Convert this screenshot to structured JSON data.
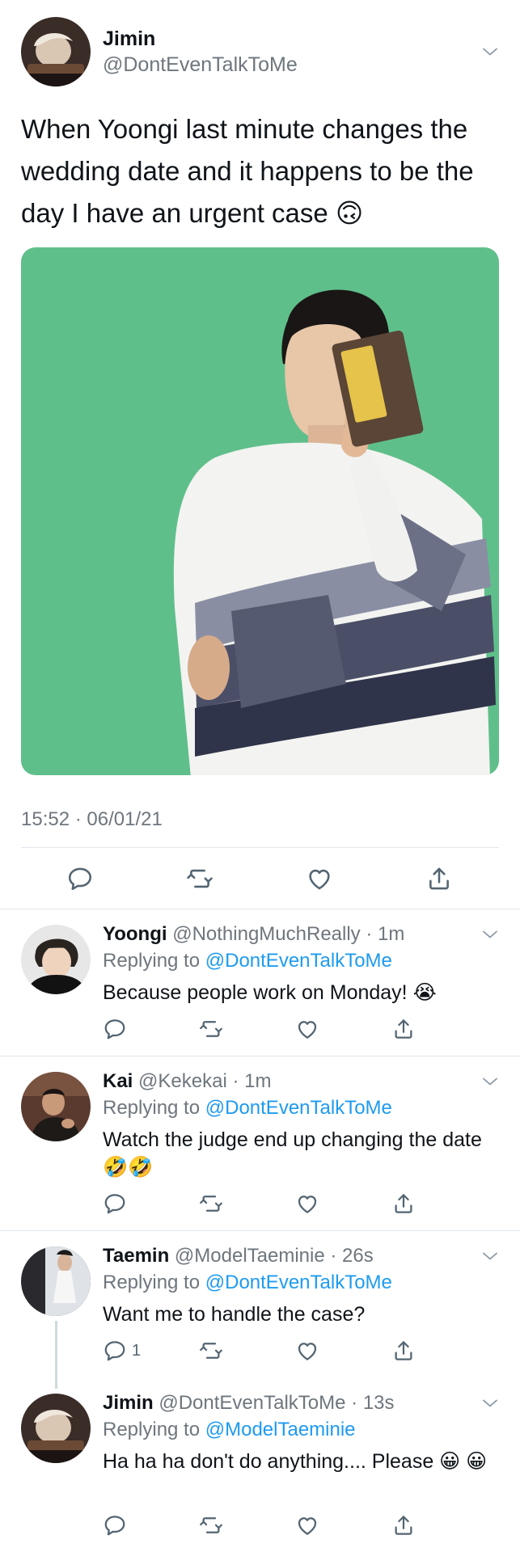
{
  "main_tweet": {
    "author_name": "Jimin",
    "author_handle": "@DontEvenTalkToMe",
    "text": "When Yoongi last minute changes the wedding date and it happens to be the day I have an urgent case 🙃",
    "timestamp": "15:52 · 06/01/21",
    "media": "photo of a person in a striped white, grey and navy shirt holding up a yellow card against a green background"
  },
  "replies": [
    {
      "name": "Yoongi",
      "handle": "@NothingMuchReally",
      "time": "· 1m",
      "replying_prefix": "Replying to",
      "replying_to": "@DontEvenTalkToMe",
      "text": "Because people work on Monday! 😭",
      "reply_count": ""
    },
    {
      "name": "Kai",
      "handle": "@Kekekai",
      "time": "· 1m",
      "replying_prefix": "Replying to",
      "replying_to": "@DontEvenTalkToMe",
      "text": "Watch the judge end up changing the date 🤣🤣",
      "reply_count": ""
    },
    {
      "name": "Taemin",
      "handle": "@ModelTaeminie",
      "time": "· 26s",
      "replying_prefix": "Replying to",
      "replying_to": "@DontEvenTalkToMe",
      "text": "Want me to handle the case?",
      "reply_count": "1"
    },
    {
      "name": "Jimin",
      "handle": "@DontEvenTalkToMe",
      "time": "· 13s",
      "replying_prefix": "Replying to",
      "replying_to": "@ModelTaeminie",
      "text": "Ha ha ha don't do anything.... Please 😀 😀",
      "reply_count": ""
    }
  ],
  "icons": [
    "reply-icon",
    "retweet-icon",
    "like-icon",
    "share-icon",
    "chevron-down-icon"
  ],
  "colors": {
    "link": "#1d9bf0",
    "muted": "#6e767d",
    "divider": "#e1e8ed",
    "media_bg": "#5fbf8a"
  }
}
